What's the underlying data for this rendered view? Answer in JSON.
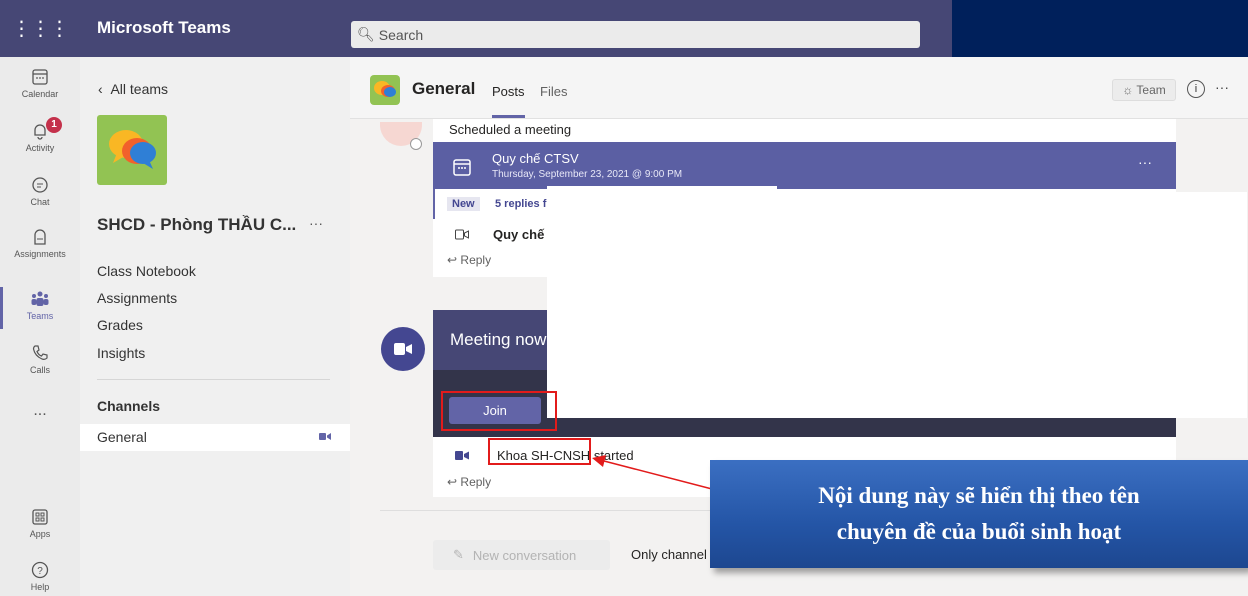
{
  "topbar": {
    "app_title": "Microsoft Teams",
    "search_placeholder": "Search"
  },
  "rail": {
    "items": [
      {
        "label": "Calendar",
        "icon": "calendar-icon"
      },
      {
        "label": "Activity",
        "icon": "bell-icon",
        "badge": "1"
      },
      {
        "label": "Chat",
        "icon": "chat-icon"
      },
      {
        "label": "Assignments",
        "icon": "assignments-icon"
      },
      {
        "label": "Teams",
        "icon": "teams-icon",
        "active": true
      },
      {
        "label": "Calls",
        "icon": "phone-icon"
      },
      {
        "label": "...",
        "icon": "more-icon"
      },
      {
        "label": "Apps",
        "icon": "apps-icon"
      },
      {
        "label": "Help",
        "icon": "help-icon"
      }
    ]
  },
  "team_panel": {
    "back_label": "All teams",
    "team_name": "SHCD - Phòng THẦU C...",
    "more": "···",
    "links": [
      "Class Notebook",
      "Assignments",
      "Grades",
      "Insights"
    ],
    "channels_heading": "Channels",
    "channel_general": "General"
  },
  "channel": {
    "title": "General",
    "tab_posts": "Posts",
    "tab_files": "Files",
    "team_button": "Team",
    "info": "i",
    "more": "···"
  },
  "post1": {
    "scheduled": "Scheduled a meeting",
    "meeting_title": "Quy chế CTSV",
    "meeting_time": "Thursday, September 23, 2021 @ 9:00 PM",
    "more": "···",
    "new_chip": "New",
    "replies": "5 replies f",
    "recording": "Quy chế",
    "reply": "Reply"
  },
  "post2": {
    "meeting_now": "Meeting now",
    "join": "Join",
    "started_name": "Khoa SH-CNSH",
    "started_suffix": " started",
    "reply": "Reply"
  },
  "footer": {
    "new_conversation": "New conversation",
    "only_channel": "Only channel"
  },
  "callout": {
    "line1": "Nội dung này sẽ hiển thị theo tên",
    "line2": "chuyên đề của buổi sinh hoạt"
  },
  "colors": {
    "brand": "#464775",
    "accent": "#6264a7",
    "highlight_red": "#e21b1b",
    "callout_blue": "#2455a6"
  }
}
